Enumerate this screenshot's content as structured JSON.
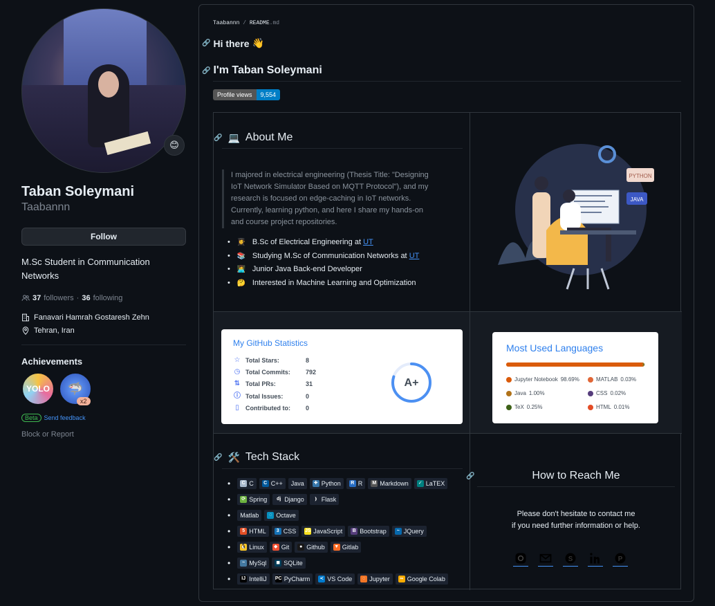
{
  "profile": {
    "name": "Taban Soleymani",
    "login": "Taabannn",
    "follow_label": "Follow",
    "bio": "M.Sc Student in Communication Networks",
    "followers_count": "37",
    "followers_label": "followers",
    "following_count": "36",
    "following_label": "following",
    "company": "Fanavari Hamrah Gostaresh Zehn",
    "location": "Tehran, Iran",
    "status_emoji": "😊"
  },
  "achievements": {
    "title": "Achievements",
    "badges": [
      {
        "name": "yolo-badge",
        "text": "YOLO"
      },
      {
        "name": "pull-shark-badge",
        "count": "x2"
      }
    ],
    "beta_label": "Beta",
    "feedback_label": "Send feedback"
  },
  "block_label": "Block or Report",
  "readme": {
    "path_owner": "Taabannn",
    "path_sep": "/",
    "path_file": "README",
    "path_ext": ".md",
    "hi": "Hi there",
    "hi_emoji": "👋",
    "heading": "I'm Taban Soleymani",
    "profile_views_label": "Profile views",
    "profile_views_value": "9,554",
    "about": {
      "title": "About Me",
      "emoji": "💻",
      "quote": "I majored in electrical engineering (Thesis Title: \"Designing IoT Network Simulator Based on MQTT Protocol\"), and my research is focused on edge-caching in IoT networks. Currently, learning python, and here I share my hands-on and course project repositories.",
      "items": [
        {
          "emoji": "👩‍🎓",
          "text": "B.Sc of Electrical Engineering at ",
          "link": "UT"
        },
        {
          "emoji": "📚",
          "text": "Studying M.Sc of Communication Networks at ",
          "link": "UT"
        },
        {
          "emoji": "👩‍💻",
          "text": "Junior Java Back-end Developer",
          "link": ""
        },
        {
          "emoji": "🤔",
          "text": "Interested in Machine Learning and Optimization",
          "link": ""
        }
      ]
    },
    "illustration_labels": {
      "python": "PYTHON",
      "java": "JAVA"
    },
    "stats": {
      "title": "My GitHub Statistics",
      "rows": [
        {
          "label": "Total Stars:",
          "value": "8",
          "icon": "star-icon"
        },
        {
          "label": "Total Commits:",
          "value": "792",
          "icon": "clock-icon"
        },
        {
          "label": "Total PRs:",
          "value": "31",
          "icon": "pull-request-icon"
        },
        {
          "label": "Total Issues:",
          "value": "0",
          "icon": "issue-icon"
        },
        {
          "label": "Contributed to:",
          "value": "0",
          "icon": "repo-icon"
        }
      ],
      "grade": "A+",
      "grade_progress": 0.8
    },
    "languages": {
      "title": "Most Used Languages",
      "items": [
        {
          "name": "Jupyter Notebook",
          "percent": "98.69%",
          "value": 98.69,
          "color": "#DA5B0B"
        },
        {
          "name": "MATLAB",
          "percent": "0.03%",
          "value": 0.03,
          "color": "#e16737"
        },
        {
          "name": "Java",
          "percent": "1.00%",
          "value": 1.0,
          "color": "#b07219"
        },
        {
          "name": "CSS",
          "percent": "0.02%",
          "value": 0.02,
          "color": "#563d7c"
        },
        {
          "name": "TeX",
          "percent": "0.25%",
          "value": 0.25,
          "color": "#3D6117"
        },
        {
          "name": "HTML",
          "percent": "0.01%",
          "value": 0.01,
          "color": "#e34c26"
        }
      ]
    },
    "tech": {
      "title": "Tech Stack",
      "emoji": "🛠️",
      "rows": [
        [
          {
            "label": "C",
            "color": "#A8B9CC",
            "glyph": "C"
          },
          {
            "label": "C++",
            "color": "#00599C",
            "glyph": "C"
          },
          {
            "label": "Java",
            "color": "",
            "glyph": ""
          },
          {
            "label": "Python",
            "color": "#3776AB",
            "glyph": "✚"
          },
          {
            "label": "R",
            "color": "#276DC3",
            "glyph": "R"
          },
          {
            "label": "Markdown",
            "color": "#555555",
            "glyph": "M"
          },
          {
            "label": "LaTEX",
            "color": "#008080",
            "glyph": "✓"
          }
        ],
        [
          {
            "label": "Spring",
            "color": "#6DB33F",
            "glyph": "⟳"
          },
          {
            "label": "Django",
            "color": "",
            "glyph": "dj"
          },
          {
            "label": "Flask",
            "color": "",
            "glyph": "⦆"
          }
        ],
        [
          {
            "label": "Matlab",
            "color": "",
            "glyph": ""
          },
          {
            "label": "Octave",
            "color": "#0790C0",
            "glyph": "◌"
          }
        ],
        [
          {
            "label": "HTML",
            "color": "#E34F26",
            "glyph": "5"
          },
          {
            "label": "CSS",
            "color": "#1572B6",
            "glyph": "3"
          },
          {
            "label": "JavaScript",
            "color": "#F7DF1E",
            "glyph": "JS"
          },
          {
            "label": "Bootstrap",
            "color": "#563D7C",
            "glyph": "B"
          },
          {
            "label": "JQuery",
            "color": "#0769AD",
            "glyph": "~"
          }
        ],
        [
          {
            "label": "Linux",
            "color": "#FCC624",
            "glyph": "🐧"
          },
          {
            "label": "Git",
            "color": "#F05032",
            "glyph": "◆"
          },
          {
            "label": "Github",
            "color": "#181717",
            "glyph": "●"
          },
          {
            "label": "Gitlab",
            "color": "#FC6D26",
            "glyph": "▼"
          }
        ],
        [
          {
            "label": "MySql",
            "color": "#4479A1",
            "glyph": "~"
          },
          {
            "label": "SQLite",
            "color": "#003B57",
            "glyph": "◼"
          }
        ],
        [
          {
            "label": "IntelliJ",
            "color": "#000000",
            "glyph": "IJ"
          },
          {
            "label": "PyCharm",
            "color": "#000000",
            "glyph": "PC"
          },
          {
            "label": "VS Code",
            "color": "#007ACC",
            "glyph": "≺"
          },
          {
            "label": "Jupyter",
            "color": "#F37626",
            "glyph": "◌"
          },
          {
            "label": "Google Colab",
            "color": "#F9AB00",
            "glyph": "∞"
          }
        ]
      ]
    },
    "reach": {
      "title": "How to Reach Me",
      "line1": "Please don't hesitate to contact me",
      "line2": "if you need further information or help.",
      "socials": [
        "instagram-icon",
        "mail-icon",
        "skype-icon",
        "linkedin-icon",
        "pinterest-icon"
      ]
    }
  }
}
